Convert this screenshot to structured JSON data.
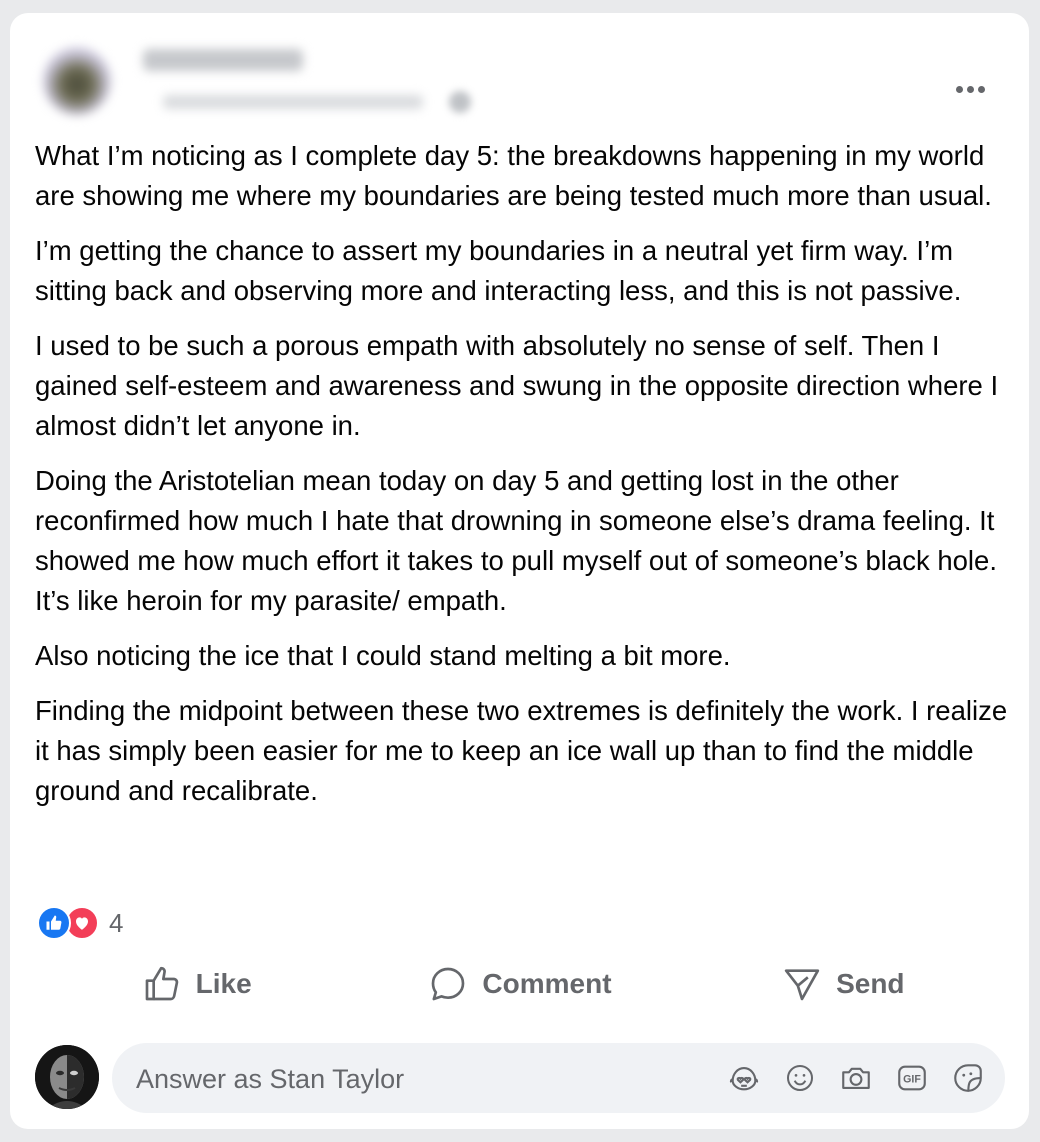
{
  "post": {
    "paragraphs": [
      "What I’m noticing as I complete day 5: the breakdowns happening in my world are showing me where my boundaries are being tested much more than usual.",
      "I’m getting the chance to assert my boundaries in a neutral yet firm way. I’m sitting back and observing more and interacting less, and this is not passive.",
      "I used to be such a porous empath with absolutely no sense of self. Then I gained self-esteem and awareness and swung in the opposite direction where I almost didn’t let anyone in.",
      "Doing the Aristotelian mean today on day 5 and getting lost in the other reconfirmed how much I hate that drowning in someone else’s drama feeling. It showed me how much effort it takes to pull myself out of someone’s black hole. It’s like heroin for my parasite/ empath.",
      "Also noticing the ice that I could stand melting a bit more.",
      "Finding the midpoint between these two extremes is definitely the work. I realize it has simply been easier for me to keep an ice wall up than to find the middle ground and recalibrate."
    ]
  },
  "reactions": {
    "types": [
      "like",
      "love"
    ],
    "count": "4"
  },
  "actions": {
    "like_label": "Like",
    "comment_label": "Comment",
    "send_label": "Send"
  },
  "composer": {
    "placeholder": "Answer as Stan Taylor",
    "icons": [
      "avatar-sticker-icon",
      "emoji-icon",
      "camera-icon",
      "gif-icon",
      "sticker-icon"
    ]
  },
  "colors": {
    "like_blue": "#1877f2",
    "love_red": "#f33e58",
    "secondary_text": "#65676b",
    "input_bg": "#f0f2f5"
  }
}
